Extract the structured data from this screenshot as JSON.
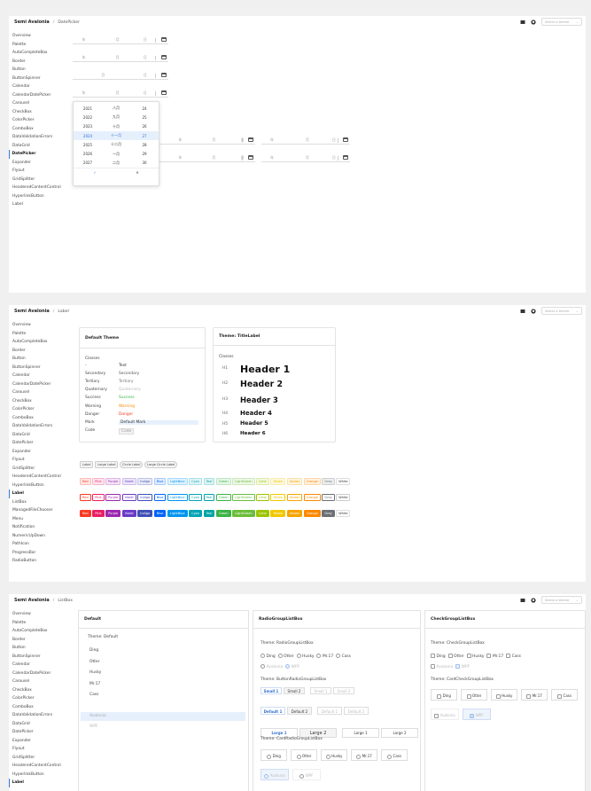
{
  "brand": "Semi Avalonia",
  "separator": "/",
  "theme_placeholder": "Select a theme",
  "colors": {
    "accent": "#3c7bd8",
    "primary_blue": "#2f6fd0"
  },
  "sidebar_items": [
    "Overview",
    "Palette",
    "AutoCompleteBox",
    "Border",
    "Button",
    "ButtonSpinner",
    "Calendar",
    "CalendarDatePicker",
    "Carousel",
    "CheckBox",
    "ColorPicker",
    "ComboBox",
    "DataValidationErrors",
    "DataGrid",
    "DatePicker",
    "Expander",
    "Flyout",
    "GridSplitter",
    "HeaderedContentControl",
    "HyperlinkButton",
    "Label",
    "ListBox",
    "ManagedFileChooser",
    "Menu",
    "Notification",
    "NumericUpDown",
    "PathIcon",
    "ProgressBar",
    "RadioButton"
  ],
  "panel1": {
    "crumb": "DatePicker",
    "field_year": "年",
    "field_month": "月",
    "field_day": "日",
    "popup_rows": [
      [
        "2021",
        "八月",
        "24"
      ],
      [
        "2022",
        "九月",
        "25"
      ],
      [
        "2023",
        "十月",
        "26"
      ],
      [
        "2024",
        "十一月",
        "27"
      ],
      [
        "2025",
        "十二月",
        "28"
      ],
      [
        "2026",
        "一月",
        "29"
      ],
      [
        "2027",
        "二月",
        "30"
      ]
    ],
    "popup_ok": "✓",
    "popup_cancel": "✕"
  },
  "panel2": {
    "crumb": "Label",
    "default_theme_title": "Default Theme",
    "title_label_title": "Theme: TitleLabel",
    "classes": "Classes",
    "rows": [
      {
        "k": "-",
        "v": "Text",
        "c": "#333"
      },
      {
        "k": "Secondary",
        "v": "Secondary",
        "c": "#555"
      },
      {
        "k": "Tertiary",
        "v": "Tertiary",
        "c": "#777"
      },
      {
        "k": "Quaternary",
        "v": "Quaternary",
        "c": "#bbb"
      },
      {
        "k": "Success",
        "v": "Success",
        "c": "#3bb346"
      },
      {
        "k": "Warning",
        "v": "Warning",
        "c": "#fc8800"
      },
      {
        "k": "Danger",
        "v": "Danger",
        "c": "#f93920"
      },
      {
        "k": "Mark",
        "v": "Default Mark",
        "c": "#333"
      },
      {
        "k": "Code",
        "v": "Code",
        "c": "#999"
      }
    ],
    "headers": [
      {
        "k": "H1",
        "v": "Header 1"
      },
      {
        "k": "H2",
        "v": "Header 2"
      },
      {
        "k": "H3",
        "v": "Header 3"
      },
      {
        "k": "H4",
        "v": "Header 4"
      },
      {
        "k": "H5",
        "v": "Header 5"
      },
      {
        "k": "H6",
        "v": "Header 6"
      }
    ],
    "label_tags": [
      "Label",
      "Large Label",
      "Circle Label",
      "Large Circle Label"
    ],
    "color_tags": [
      "Red",
      "Pink",
      "Purple",
      "Violet",
      "Indigo",
      "Blue",
      "LightBlue",
      "Cyan",
      "Teal",
      "Green",
      "LightGreen",
      "Lime",
      "Yellow",
      "Amber",
      "Orange",
      "Grey",
      "White"
    ],
    "tag_colors": [
      "#f93920",
      "#e91e63",
      "#9c27b0",
      "#6a3ac7",
      "#3f51b5",
      "#0064fa",
      "#0095ee",
      "#05a4b6",
      "#00a3a3",
      "#3bb346",
      "#6bbd3a",
      "#9bc400",
      "#f0c800",
      "#f5a400",
      "#fc8800",
      "#6b7075",
      "#ffffff"
    ]
  },
  "panel3": {
    "crumb": "ListBox",
    "col1_title": "Default",
    "col2_title": "RadioGroupListBox",
    "col3_title": "CheckGroupListBox",
    "theme_default": "Theme: Default",
    "list_items": [
      "Ding",
      "Otter",
      "Husky",
      "Mr.17",
      "Cass"
    ],
    "disabled_items": [
      "Avalonia",
      "WPF"
    ],
    "theme_radio": "Theme: RadioGroupListBox",
    "theme_button_radio": "Theme: ButtonRadioGroupListBox",
    "theme_card_radio": "Theme: CardRadioGroupListBox",
    "theme_check": "Theme: CheckGroupListBox",
    "theme_card_check": "Theme: CardCheckGroupListBox",
    "small_buttons": [
      "Small 1",
      "Small 2",
      "Small 1",
      "Small 2"
    ],
    "default_buttons": [
      "Default 1",
      "Default 2",
      "Default 1",
      "Default 2"
    ],
    "large_buttons": [
      "Large 1",
      "Large 2",
      "Large 1",
      "Large 2"
    ]
  }
}
